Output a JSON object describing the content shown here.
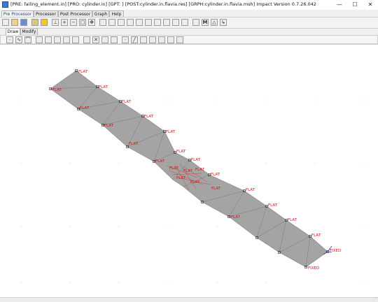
{
  "window": {
    "title": "[PRE: failing_element.in] [PRO: cylinder.in] [GPT: ] [POST:cylinder.in.flavia.res] [GRPH:cylinder.in.flavia.msh] Impact Version 0.7.26.042",
    "minimize": "—",
    "maximize": "☐",
    "close": "✕"
  },
  "menu": {
    "tabs": [
      "Pre Processor",
      "Processor",
      "Post Processor",
      "Graph",
      "Help"
    ]
  },
  "subtabs": [
    "Draw",
    "Modify"
  ],
  "canvas": {
    "labels": [
      "FLAT",
      "FLAT",
      "FLAT",
      "FLAT",
      "FLAT",
      "FLAT",
      "FLAT",
      "FLAT",
      "FLAT",
      "FLAT",
      "FLAT",
      "FLAT",
      "FLAT",
      "FLAT",
      "FLAT",
      "FLAT",
      "FLAT",
      "FLAT",
      "FLAT",
      "FLAT",
      "FLAT",
      "FLAT",
      "FLAT",
      "FLAT",
      "FIXED",
      "FIXED"
    ],
    "mesh_color": "#a4a4a4",
    "edge_color": "#7a7a7a",
    "label_color": "#dd1111"
  }
}
